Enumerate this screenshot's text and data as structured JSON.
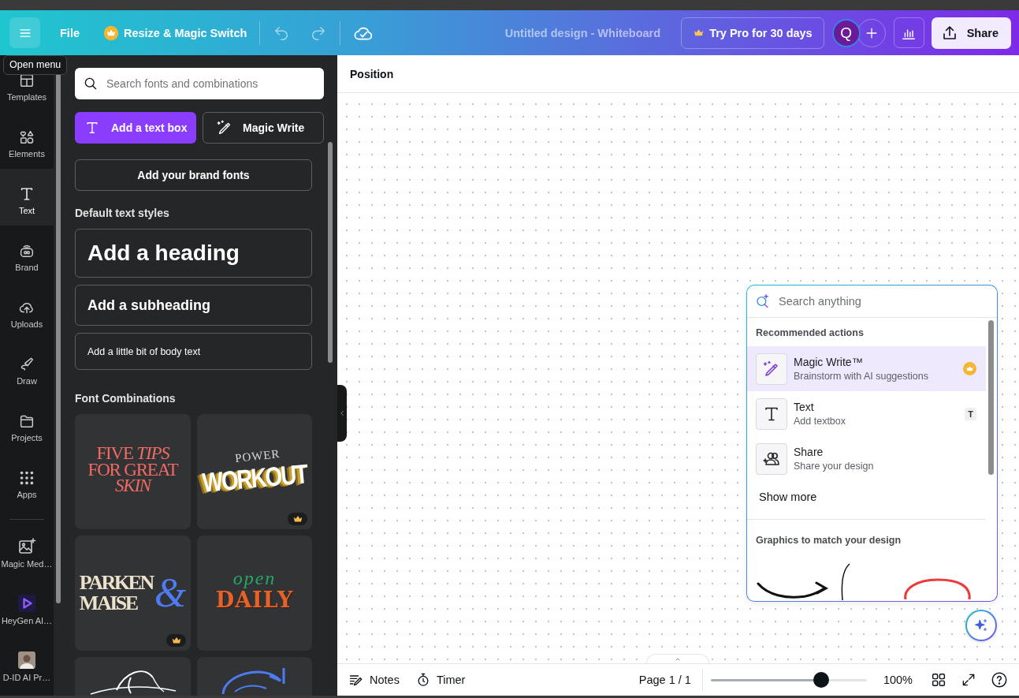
{
  "topbar": {
    "menu_tooltip": "Open menu",
    "file": "File",
    "resize": "Resize & Magic Switch",
    "title": "Untitled design - Whiteboard",
    "try_pro": "Try Pro for 30 days",
    "avatar": "Q",
    "share": "Share"
  },
  "rail": {
    "items": [
      {
        "label": "Templates",
        "selected": false
      },
      {
        "label": "Elements",
        "selected": false
      },
      {
        "label": "Text",
        "selected": true
      },
      {
        "label": "Brand",
        "selected": false
      },
      {
        "label": "Uploads",
        "selected": false
      },
      {
        "label": "Draw",
        "selected": false
      },
      {
        "label": "Projects",
        "selected": false
      },
      {
        "label": "Apps",
        "selected": false
      }
    ],
    "apps": [
      {
        "label": "Magic Med…"
      },
      {
        "label": "HeyGen AI…"
      },
      {
        "label": "D-ID AI Pr…"
      }
    ]
  },
  "panel": {
    "search": {
      "placeholder": "Search fonts and combinations"
    },
    "add_text_box": "Add a text box",
    "magic_write": "Magic Write",
    "brand_fonts": "Add your brand fonts",
    "default_heading": "Default text styles",
    "styles": [
      {
        "kind": "heading",
        "label": "Add a heading"
      },
      {
        "kind": "subheading",
        "label": "Add a subheading"
      },
      {
        "kind": "body",
        "label": "Add a little bit of body text"
      }
    ],
    "combos_heading": "Font Combinations",
    "combos": [
      {
        "kind": "serif",
        "text": "FIVE *TIPS* FOR GREAT *SKIN*",
        "pro": false
      },
      {
        "kind": "block",
        "small": "POWER",
        "big": "WORKOUT",
        "pro": true
      },
      {
        "kind": "monogram",
        "top": "PARKEN",
        "bottom": "MAISE",
        "mark": "&",
        "pro": true
      },
      {
        "kind": "script",
        "small": "open",
        "big": "DAILY",
        "pro": false
      },
      {
        "kind": "picture"
      },
      {
        "kind": "picture"
      }
    ]
  },
  "canvas": {
    "toolbar_label": "Position",
    "search_popup": {
      "placeholder": "Search anything",
      "section": "Recommended actions",
      "actions": [
        {
          "kind": "magic-write",
          "title": "Magic Write™",
          "subtitle": "Brainstorm with AI suggestions",
          "selected": true,
          "pro": true
        },
        {
          "kind": "text",
          "title": "Text",
          "subtitle": "Add textbox",
          "selected": false,
          "shortcut": "T"
        },
        {
          "kind": "share",
          "title": "Share",
          "subtitle": "Share your design",
          "selected": false
        }
      ],
      "show_more": "Show more",
      "graphics_heading": "Graphics to match your design"
    }
  },
  "bottom_bar": {
    "notes": "Notes",
    "timer": "Timer",
    "page": "Page 1 / 1",
    "zoom": {
      "level": 0.71
    },
    "zoom_reading": "100%"
  }
}
